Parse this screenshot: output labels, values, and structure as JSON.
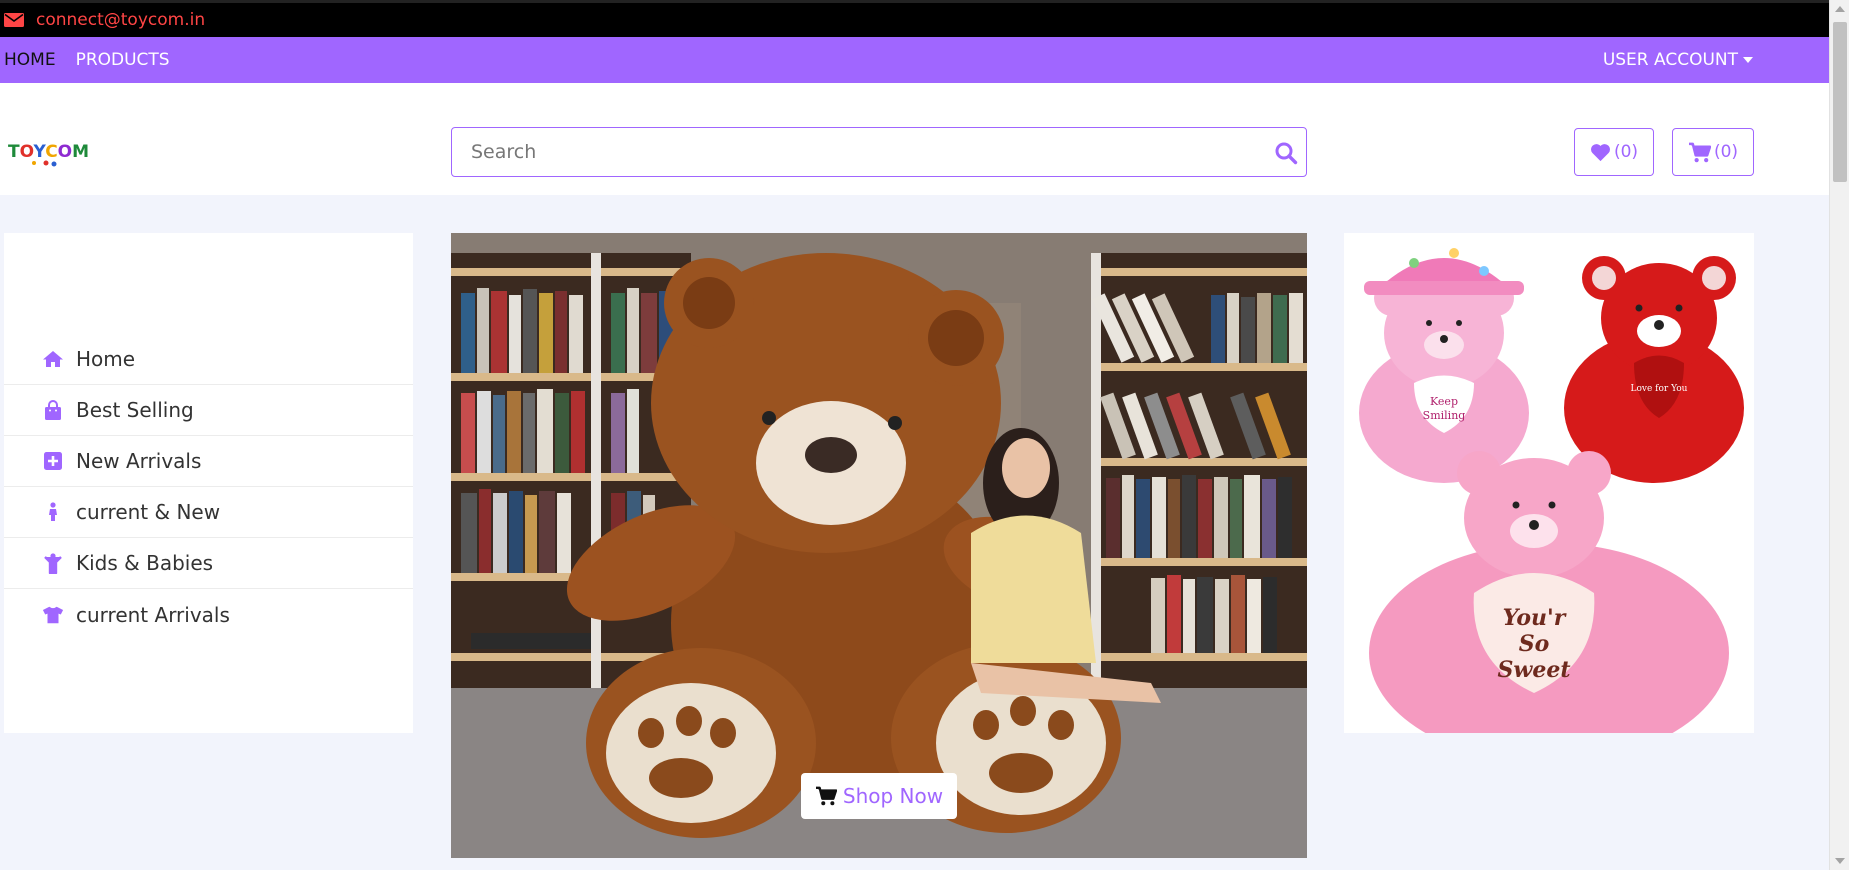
{
  "topbar": {
    "email": "connect@toycom.in",
    "icon": "envelope-icon"
  },
  "nav": {
    "home": "HOME",
    "products": "PRODUCTS",
    "account": "USER ACCOUNT"
  },
  "header": {
    "logo_text": "TOYCOM",
    "search_placeholder": "Search",
    "wishlist_count": "(0)",
    "cart_count": "(0)"
  },
  "sidebar": {
    "items": [
      {
        "label": "Home",
        "icon": "home-icon"
      },
      {
        "label": "Best Selling",
        "icon": "shopping-bag-icon"
      },
      {
        "label": "New Arrivals",
        "icon": "plus-square-icon"
      },
      {
        "label": "current & New",
        "icon": "child-icon"
      },
      {
        "label": "Kids & Babies",
        "icon": "child-arms-up-icon"
      },
      {
        "label": "current Arrivals",
        "icon": "tshirt-icon"
      }
    ]
  },
  "banner": {
    "button_label": "Shop Now"
  },
  "side_images": {
    "heart_texts": [
      "Keep Smiling",
      "Love for You",
      "You'r So Sweet"
    ]
  },
  "colors": {
    "accent": "#a066ff",
    "topbar": "#000000",
    "email": "#ff4545",
    "background": "#f2f4fc"
  }
}
